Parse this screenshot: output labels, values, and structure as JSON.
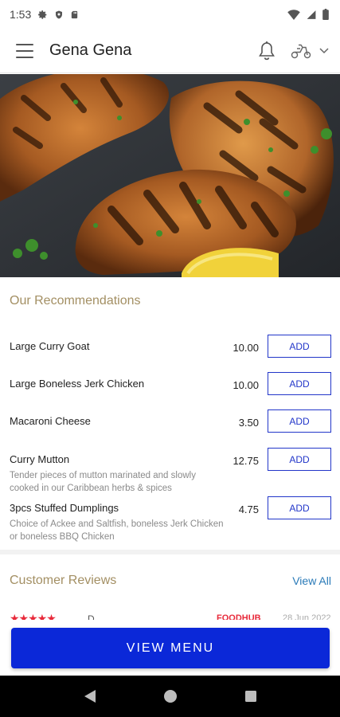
{
  "status_bar": {
    "time": "1:53"
  },
  "header": {
    "title": "Gena Gena",
    "icons": [
      "menu-icon",
      "bell-icon",
      "scooter-icon",
      "chevron-down-icon"
    ]
  },
  "recommendations": {
    "title": "Our Recommendations",
    "add_label": "ADD",
    "items": [
      {
        "name": "Large Curry Goat",
        "description": "",
        "price": "10.00"
      },
      {
        "name": "Large Boneless Jerk Chicken",
        "description": "",
        "price": "10.00"
      },
      {
        "name": "Macaroni Cheese",
        "description": "",
        "price": "3.50"
      },
      {
        "name": "Curry Mutton",
        "description": "Tender pieces of mutton marinated and slowly cooked in our Caribbean herbs & spices",
        "price": "12.75"
      },
      {
        "name": "3pcs Stuffed Dumplings",
        "description": "Choice of Ackee and Saltfish, boneless Jerk Chicken or boneless BBQ Chicken",
        "price": "4.75"
      }
    ]
  },
  "reviews": {
    "title": "Customer Reviews",
    "view_all_label": "View All",
    "peek": {
      "stars": "★★★★★",
      "name": "D",
      "source": "FOODHUB",
      "date": "28 Jun 2022"
    }
  },
  "cta": {
    "view_menu_label": "VIEW MENU"
  },
  "colors": {
    "primary": "#0b28d8",
    "add_outline": "#2236c9",
    "section_title": "#a38f63",
    "link": "#2a7ab8",
    "star": "#e8293a"
  }
}
